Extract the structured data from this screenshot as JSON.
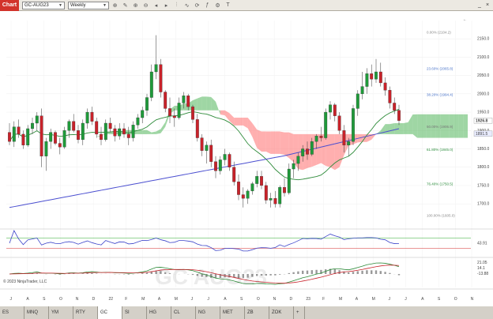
{
  "toolbar": {
    "chart_tab": "Chart",
    "symbol": "GC-AUG23",
    "period": "Weekly",
    "tool_icons": [
      "crosshair-icon",
      "pencil-icon",
      "zoom-in-icon",
      "zoom-out-icon",
      "arrow-left-icon",
      "arrow-right-icon",
      "bar-style-icon",
      "line-style-icon",
      "sync-icon",
      "indicator-icon",
      "settings-icon",
      "text-icon"
    ]
  },
  "window": {
    "minimize": "_",
    "close": "×"
  },
  "chart_data": {
    "type": "candlestick",
    "symbol": "GC-AUG23",
    "interval": "Weekly",
    "watermark": "GC AUG23",
    "copyright": "© 2023 NinjaTrader, LLC",
    "price_axis": {
      "ylim": [
        1640,
        2200
      ],
      "ticks": [
        1700,
        1750,
        1800,
        1850,
        1900,
        1950,
        2000,
        2050,
        2100,
        2150
      ],
      "tick_labels": [
        "1700.0",
        "1750.0",
        "1800.0",
        "1850.0",
        "1900.0",
        "1950.0",
        "2000.0",
        "2050.0",
        "2100.0",
        "2150.0"
      ],
      "last_price": "1926.8",
      "ma_price": "1891.5"
    },
    "x_axis_labels": [
      "J",
      "A",
      "S",
      "O",
      "N",
      "D",
      "22",
      "F",
      "M",
      "A",
      "M",
      "J",
      "J",
      "A",
      "S",
      "O",
      "N",
      "D",
      "23",
      "F",
      "M",
      "A",
      "M",
      "J",
      "J",
      "A",
      "S",
      "O",
      "N"
    ],
    "fib_levels": [
      {
        "label": "0.00% (2104.2)",
        "value": 2164.2,
        "color": "#888888"
      },
      {
        "label": "23.60% (2065.8)",
        "value": 2065.8,
        "color": "#4a74c9"
      },
      {
        "label": "38.20% (1994.4)",
        "value": 1994.4,
        "color": "#4a74c9"
      },
      {
        "label": "50.00% (1906.9)",
        "value": 1906.9,
        "color": "#777777"
      },
      {
        "label": "61.80% (1845.0)",
        "value": 1845.0,
        "color": "#2f8f3f"
      },
      {
        "label": "76.40% (1750.5)",
        "value": 1750.5,
        "color": "#2f8f3f"
      },
      {
        "label": "100.00% (1605.0)",
        "value": 1665.0,
        "color": "#888888"
      }
    ],
    "candles": [
      [
        1895,
        1920,
        1860,
        1870
      ],
      [
        1870,
        1925,
        1855,
        1910
      ],
      [
        1910,
        1930,
        1880,
        1890
      ],
      [
        1890,
        1900,
        1850,
        1860
      ],
      [
        1860,
        1915,
        1855,
        1905
      ],
      [
        1905,
        1935,
        1890,
        1920
      ],
      [
        1920,
        1950,
        1900,
        1940
      ],
      [
        1940,
        1960,
        1800,
        1830
      ],
      [
        1830,
        1880,
        1790,
        1870
      ],
      [
        1870,
        1905,
        1850,
        1895
      ],
      [
        1895,
        1900,
        1860,
        1865
      ],
      [
        1865,
        1880,
        1835,
        1855
      ],
      [
        1855,
        1910,
        1850,
        1900
      ],
      [
        1900,
        1930,
        1880,
        1925
      ],
      [
        1925,
        1945,
        1895,
        1900
      ],
      [
        1900,
        1915,
        1865,
        1875
      ],
      [
        1875,
        1930,
        1860,
        1920
      ],
      [
        1920,
        1960,
        1905,
        1950
      ],
      [
        1950,
        1965,
        1915,
        1925
      ],
      [
        1925,
        1935,
        1880,
        1890
      ],
      [
        1890,
        1910,
        1860,
        1875
      ],
      [
        1875,
        1930,
        1870,
        1920
      ],
      [
        1920,
        1935,
        1895,
        1905
      ],
      [
        1905,
        1915,
        1870,
        1885
      ],
      [
        1885,
        1920,
        1875,
        1905
      ],
      [
        1905,
        1920,
        1880,
        1890
      ],
      [
        1890,
        1910,
        1860,
        1880
      ],
      [
        1880,
        1925,
        1870,
        1915
      ],
      [
        1915,
        1945,
        1905,
        1935
      ],
      [
        1935,
        1965,
        1920,
        1955
      ],
      [
        1955,
        2000,
        1940,
        1990
      ],
      [
        1990,
        2080,
        1980,
        2060
      ],
      [
        2060,
        2160,
        2040,
        2080
      ],
      [
        2080,
        2095,
        1990,
        2005
      ],
      [
        2005,
        2010,
        1950,
        1960
      ],
      [
        1960,
        1990,
        1920,
        1940
      ],
      [
        1940,
        1960,
        1910,
        1935
      ],
      [
        1935,
        1990,
        1930,
        1975
      ],
      [
        1975,
        2005,
        1960,
        1995
      ],
      [
        1995,
        2000,
        1955,
        1965
      ],
      [
        1965,
        1970,
        1920,
        1930
      ],
      [
        1930,
        1945,
        1870,
        1880
      ],
      [
        1880,
        1890,
        1830,
        1845
      ],
      [
        1845,
        1870,
        1810,
        1860
      ],
      [
        1860,
        1875,
        1800,
        1815
      ],
      [
        1815,
        1830,
        1770,
        1790
      ],
      [
        1790,
        1830,
        1780,
        1820
      ],
      [
        1820,
        1850,
        1805,
        1835
      ],
      [
        1835,
        1840,
        1790,
        1800
      ],
      [
        1800,
        1815,
        1750,
        1760
      ],
      [
        1760,
        1780,
        1710,
        1725
      ],
      [
        1725,
        1745,
        1690,
        1715
      ],
      [
        1715,
        1740,
        1700,
        1735
      ],
      [
        1735,
        1760,
        1725,
        1755
      ],
      [
        1755,
        1790,
        1745,
        1775
      ],
      [
        1775,
        1790,
        1740,
        1750
      ],
      [
        1750,
        1760,
        1700,
        1710
      ],
      [
        1710,
        1730,
        1690,
        1715
      ],
      [
        1715,
        1735,
        1690,
        1700
      ],
      [
        1700,
        1750,
        1690,
        1745
      ],
      [
        1745,
        1770,
        1720,
        1730
      ],
      [
        1730,
        1810,
        1725,
        1795
      ],
      [
        1795,
        1820,
        1770,
        1810
      ],
      [
        1810,
        1840,
        1790,
        1830
      ],
      [
        1830,
        1860,
        1815,
        1850
      ],
      [
        1850,
        1870,
        1820,
        1835
      ],
      [
        1835,
        1880,
        1830,
        1870
      ],
      [
        1870,
        1890,
        1850,
        1885
      ],
      [
        1885,
        1910,
        1870,
        1880
      ],
      [
        1880,
        1960,
        1875,
        1950
      ],
      [
        1950,
        1980,
        1930,
        1970
      ],
      [
        1970,
        1975,
        1925,
        1940
      ],
      [
        1940,
        1950,
        1890,
        1900
      ],
      [
        1900,
        1915,
        1840,
        1860
      ],
      [
        1860,
        1880,
        1830,
        1870
      ],
      [
        1870,
        1970,
        1860,
        1960
      ],
      [
        1960,
        2010,
        1940,
        2000
      ],
      [
        2000,
        2060,
        1985,
        2020
      ],
      [
        2020,
        2070,
        2000,
        2055
      ],
      [
        2055,
        2080,
        2020,
        2040
      ],
      [
        2040,
        2095,
        2030,
        2060
      ],
      [
        2060,
        2085,
        2020,
        2030
      ],
      [
        2030,
        2045,
        1995,
        2010
      ],
      [
        2010,
        2020,
        1960,
        1975
      ],
      [
        1975,
        1990,
        1945,
        1955
      ],
      [
        1955,
        1970,
        1915,
        1927
      ]
    ],
    "rsi": {
      "ylim": [
        0,
        100
      ],
      "ticks": [
        30,
        50,
        70
      ],
      "last": "43.91",
      "last2": "42.99"
    },
    "macd": {
      "last": [
        "21.05",
        "14.1",
        "-13.88"
      ]
    }
  },
  "instrument_tabs": [
    "ES",
    "MNQ",
    "YM",
    "RTY",
    "GC",
    "SI",
    "HG",
    "CL",
    "NG",
    "MET",
    "ZB",
    "ZOK",
    "+"
  ],
  "active_tab": "GC"
}
